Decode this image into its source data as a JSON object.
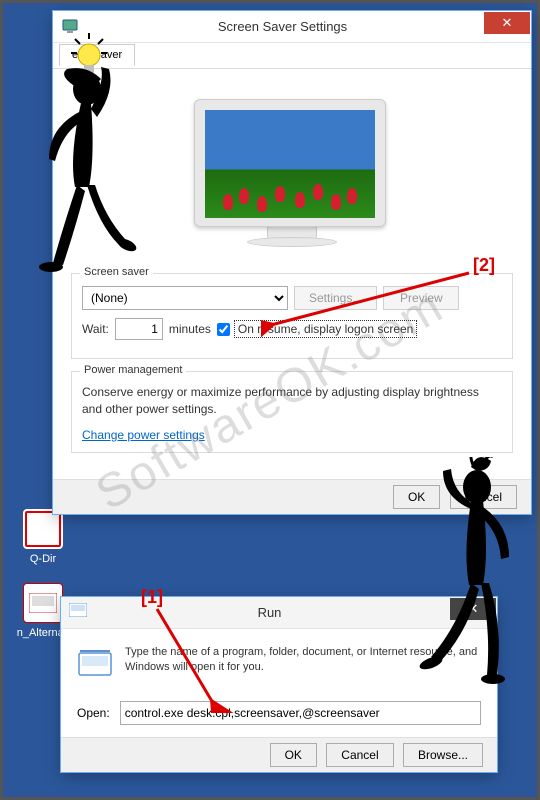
{
  "desktop": {
    "icons": [
      {
        "name": "Q-Dir"
      },
      {
        "name": "n_Alternati"
      }
    ]
  },
  "screensaver_dialog": {
    "title": "Screen Saver Settings",
    "tab_label": "een Saver",
    "group_label": "Screen saver",
    "dropdown_value": "(None)",
    "settings_btn": "Settings...",
    "preview_btn": "Preview",
    "wait_label": "Wait:",
    "wait_value": "1",
    "wait_unit": "minutes",
    "resume_checkbox": "On resume, display logon screen",
    "power_group_label": "Power management",
    "power_desc": "Conserve energy or maximize performance by adjusting display brightness and other power settings.",
    "power_link": "Change power settings",
    "ok_btn": "OK",
    "cancel_btn": "Cancel"
  },
  "run_dialog": {
    "title": "Run",
    "instruction": "Type the name of a program, folder, document, or Internet resource, and Windows will open it for you.",
    "open_label": "Open:",
    "open_value": "control.exe desk.cpl,screensaver,@screensaver",
    "ok_btn": "OK",
    "cancel_btn": "Cancel",
    "browse_btn": "Browse..."
  },
  "annotations": {
    "label1": "[1]",
    "label2": "[2]"
  },
  "watermark": "SoftwareOK.com"
}
